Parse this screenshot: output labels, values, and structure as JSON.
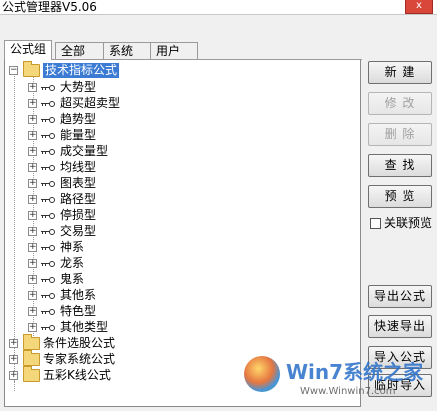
{
  "window": {
    "title": "公式管理器V5.06",
    "close_label": "x"
  },
  "tabs": [
    {
      "label": "公式组",
      "active": true
    },
    {
      "label": "全部",
      "active": false
    },
    {
      "label": "系统",
      "active": false
    },
    {
      "label": "用户",
      "active": false
    }
  ],
  "tree": {
    "root": {
      "label": "技术指标公式",
      "expanded": true,
      "selected": true
    },
    "children": [
      "大势型",
      "超买超卖型",
      "趋势型",
      "能量型",
      "成交量型",
      "均线型",
      "图表型",
      "路径型",
      "停损型",
      "交易型",
      "神系",
      "龙系",
      "鬼系",
      "其他系",
      "特色型",
      "其他类型"
    ],
    "groups": [
      "条件选股公式",
      "专家系统公式",
      "五彩K线公式"
    ]
  },
  "buttons": {
    "new": "新 建",
    "modify": "修 改",
    "delete": "删 除",
    "find": "查 找",
    "preview": "预 览",
    "export": "导出公式",
    "quick_export": "快速导出",
    "import": "导入公式",
    "temp_import": "临时导入"
  },
  "linked_preview": {
    "label": "关联预览",
    "checked": false
  },
  "watermark": {
    "brand": "Win7系统之家",
    "url": "Www.Winwin7.com"
  },
  "colors": {
    "selection": "#3b7bd4",
    "folder": "#f4d77a"
  }
}
